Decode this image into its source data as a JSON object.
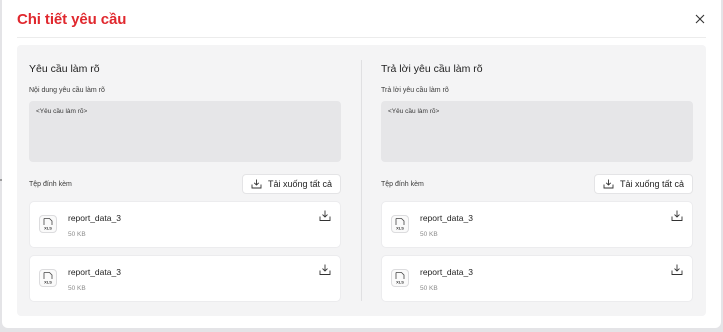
{
  "modal": {
    "title": "Chi tiết yêu cầu",
    "close_icon": "close-icon"
  },
  "request": {
    "section_title": "Yêu cầu làm rõ",
    "content_label": "Nội dung yêu cầu làm rõ",
    "content_placeholder": "<Yêu cầu làm rõ>",
    "attachments_label": "Tệp đính kèm",
    "download_all_label": "Tải xuống tất cả",
    "files": [
      {
        "name": "report_data_3",
        "size": "50 KB",
        "type_icon": "xls-file-icon"
      },
      {
        "name": "report_data_3",
        "size": "50 KB",
        "type_icon": "xls-file-icon"
      }
    ]
  },
  "reply": {
    "section_title": "Trả lời yêu cầu làm rõ",
    "content_label": "Trả lời yêu cầu làm rõ",
    "content_placeholder": "<Yêu cầu làm rõ>",
    "attachments_label": "Tệp đính kèm",
    "download_all_label": "Tải xuống tất cả",
    "files": [
      {
        "name": "report_data_3",
        "size": "50 KB",
        "type_icon": "xls-file-icon"
      },
      {
        "name": "report_data_3",
        "size": "50 KB",
        "type_icon": "xls-file-icon"
      }
    ]
  },
  "icons": {
    "xls_label": "XLS"
  },
  "colors": {
    "title": "#e0282e",
    "panel_bg": "#f4f4f5",
    "textarea_bg": "#e6e6e8"
  }
}
